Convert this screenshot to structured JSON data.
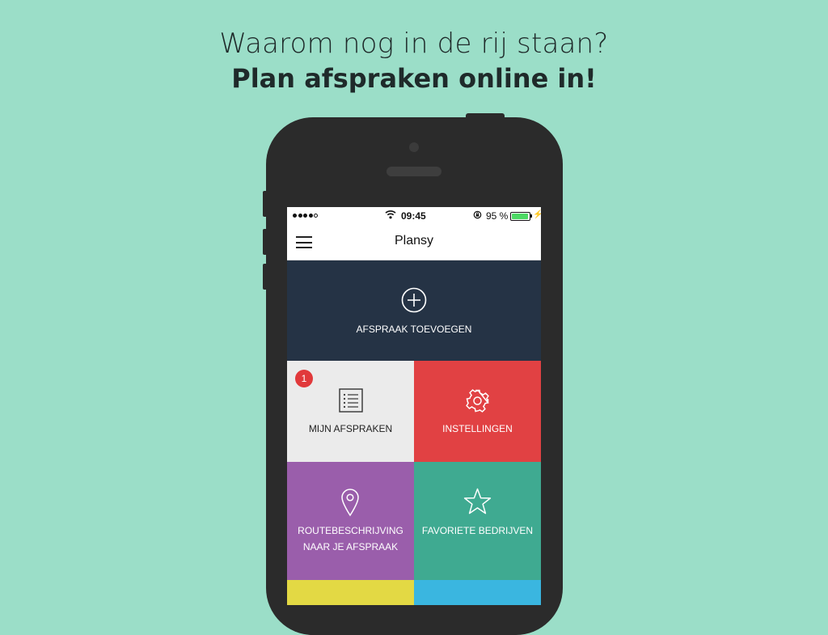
{
  "headline": {
    "line1": "Waarom nog in de rij staan?",
    "line2": "Plan afspraken online in!"
  },
  "status_bar": {
    "time": "09:45",
    "battery_percent": "95 %",
    "battery_level": 0.95,
    "signal_bars_filled": 4,
    "signal_bars_total": 5
  },
  "nav": {
    "title": "Plansy"
  },
  "hero": {
    "label": "AFSPRAAK TOEVOEGEN",
    "icon": "plus-circle-icon"
  },
  "tiles": {
    "mijn_afspraken": {
      "label": "MIJN AFSPRAKEN",
      "badge": "1",
      "icon": "list-icon",
      "color": "#ebebeb"
    },
    "instellingen": {
      "label": "INSTELLINGEN",
      "icon": "gear-icon",
      "color": "#e14143"
    },
    "route": {
      "label_line1": "ROUTEBESCHRIJVING",
      "label_line2": "NAAR JE AFSPRAAK",
      "icon": "location-pin-icon",
      "color": "#9a5eab"
    },
    "favoriete": {
      "label": "FAVORIETE BEDRIJVEN",
      "icon": "star-icon",
      "color": "#3faa91"
    }
  },
  "colors": {
    "background": "#9bdec8",
    "phone_body": "#2b2b2b",
    "hero": "#253345",
    "yellow_tile": "#e3d944",
    "blue_tile": "#3ab6e0"
  }
}
